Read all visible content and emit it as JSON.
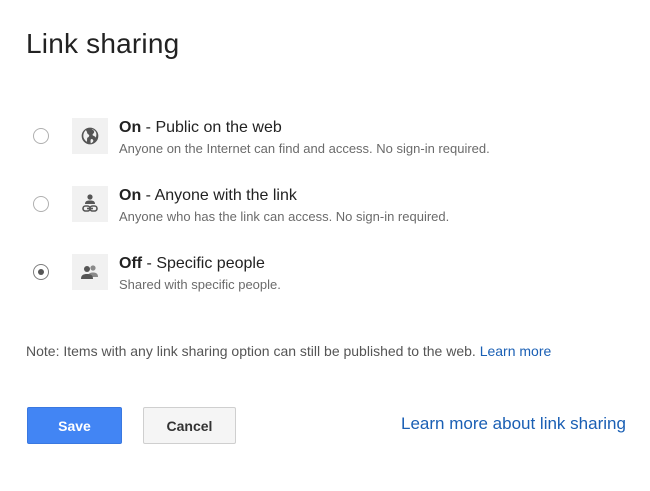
{
  "dialog": {
    "title": "Link sharing"
  },
  "options": [
    {
      "state": "On",
      "separator": " - ",
      "label": "Public on the web",
      "description": "Anyone on the Internet can find and access. No sign-in required.",
      "icon": "globe-icon",
      "selected": false
    },
    {
      "state": "On",
      "separator": " - ",
      "label": "Anyone with the link",
      "description": "Anyone who has the link can access. No sign-in required.",
      "icon": "person-link-icon",
      "selected": false
    },
    {
      "state": "Off",
      "separator": " - ",
      "label": "Specific people",
      "description": "Shared with specific people.",
      "icon": "people-icon",
      "selected": true
    }
  ],
  "note": {
    "text": "Note: Items with any link sharing option can still be published to the web. ",
    "link": "Learn more"
  },
  "buttons": {
    "save": "Save",
    "cancel": "Cancel"
  },
  "footer": {
    "learn_more_link": "Learn more about link sharing"
  },
  "colors": {
    "accent": "#4285f4",
    "link": "#1a5fb4"
  }
}
